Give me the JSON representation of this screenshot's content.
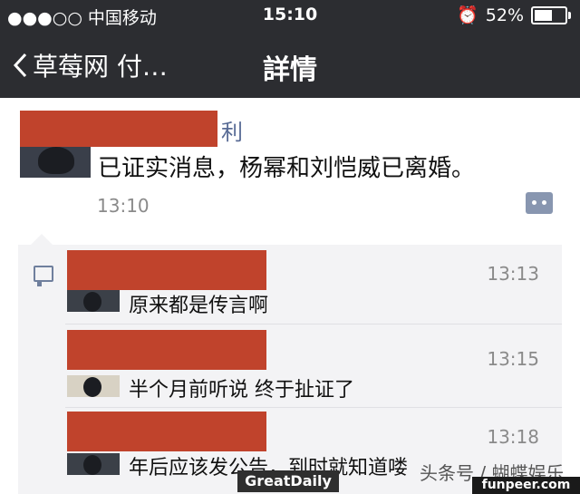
{
  "status": {
    "carrier": "●●●○○ 中国移动",
    "time": "15:10",
    "battery": "52%",
    "battery_level": 0.52
  },
  "nav": {
    "back_label": "草莓网 付…",
    "title": "詳情"
  },
  "post": {
    "name_visible": "利",
    "text": "已证实消息，杨幂和刘恺威已离婚。",
    "time": "13:10"
  },
  "comments": [
    {
      "text": "原来都是传言啊",
      "time": "13:13"
    },
    {
      "text": "半个月前听说 终于扯证了",
      "time": "13:15"
    },
    {
      "text": "年后应该发公告，到时就知道喽",
      "time": "13:18"
    }
  ],
  "watermarks": {
    "toutiao": "头条号 / 蝴蝶娱乐",
    "greatdaily": "GreatDaily",
    "funpeer": "funpeer.com"
  }
}
